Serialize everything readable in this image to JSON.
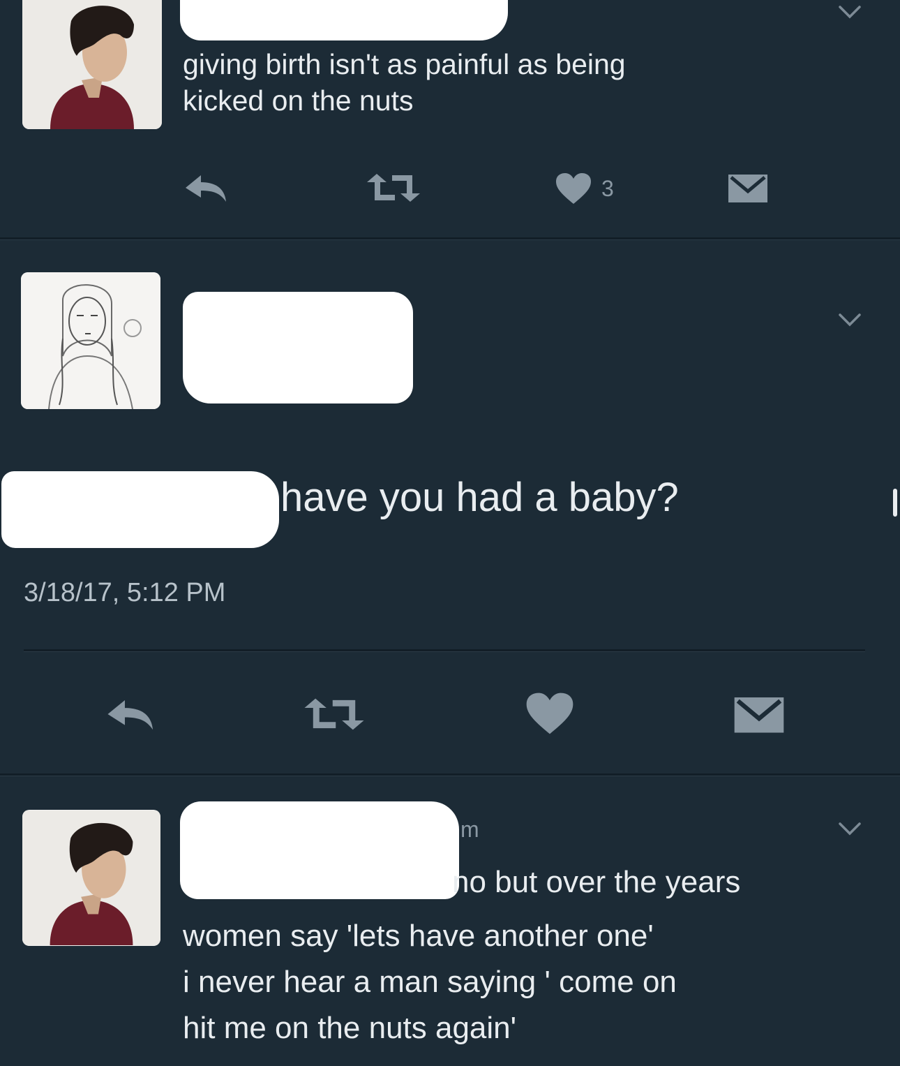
{
  "tweets": [
    {
      "text_lines": [
        "giving birth isn't as painful as being",
        "kicked on the nuts"
      ],
      "like_count": "3"
    },
    {
      "text": "have you had a baby?",
      "timestamp": "3/18/17, 5:12 PM"
    },
    {
      "partial_handle_char": "m",
      "text_lines": [
        "no but over the years",
        "women say 'lets have another one'",
        "i never hear a man saying ' come on",
        "hit me on the nuts again'"
      ]
    }
  ],
  "icons": {
    "reply": "reply-icon",
    "retweet": "retweet-icon",
    "like": "heart-icon",
    "dm": "envelope-icon",
    "caret": "chevron-down-icon"
  },
  "colors": {
    "background": "#1c2b36",
    "icon": "#8a98a3",
    "text": "#e9edf0"
  }
}
